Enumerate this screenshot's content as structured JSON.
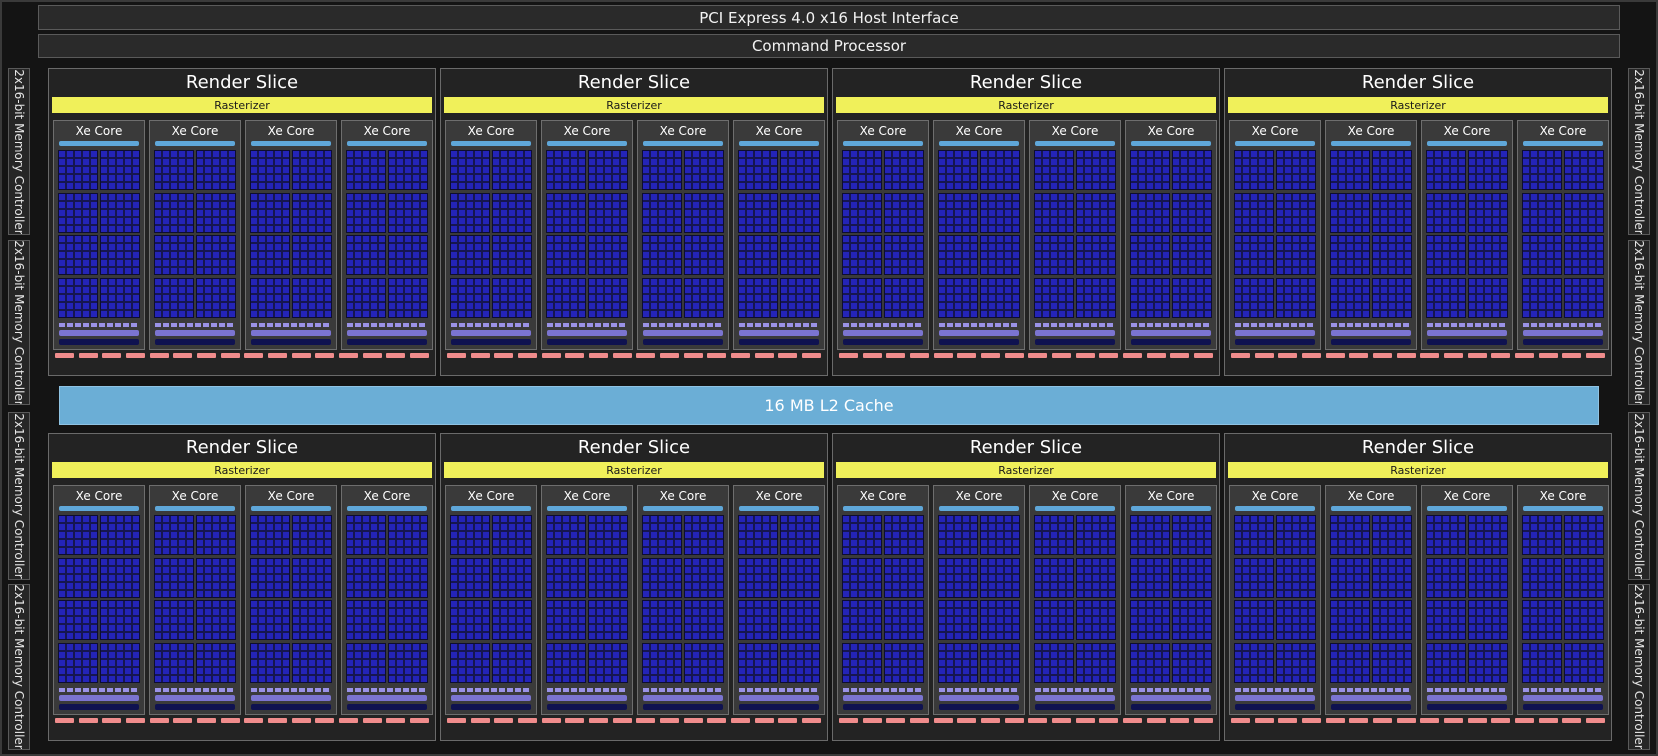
{
  "host_interface": "PCI Express 4.0 x16 Host Interface",
  "command_processor": "Command Processor",
  "l2_cache": "16 MB L2 Cache",
  "memory_controllers": [
    "2x16-bit Memory Controller",
    "2x16-bit Memory Controller",
    "2x16-bit Memory Controller",
    "2x16-bit Memory Controller",
    "2x16-bit Memory Controller",
    "2x16-bit Memory Controller",
    "2x16-bit Memory Controller",
    "2x16-bit Memory Controller"
  ],
  "render_slices": [
    {
      "title": "Render Slice",
      "rasterizer": "Rasterizer",
      "cores": [
        "Xe Core",
        "Xe Core",
        "Xe Core",
        "Xe Core"
      ]
    },
    {
      "title": "Render Slice",
      "rasterizer": "Rasterizer",
      "cores": [
        "Xe Core",
        "Xe Core",
        "Xe Core",
        "Xe Core"
      ]
    },
    {
      "title": "Render Slice",
      "rasterizer": "Rasterizer",
      "cores": [
        "Xe Core",
        "Xe Core",
        "Xe Core",
        "Xe Core"
      ]
    },
    {
      "title": "Render Slice",
      "rasterizer": "Rasterizer",
      "cores": [
        "Xe Core",
        "Xe Core",
        "Xe Core",
        "Xe Core"
      ]
    },
    {
      "title": "Render Slice",
      "rasterizer": "Rasterizer",
      "cores": [
        "Xe Core",
        "Xe Core",
        "Xe Core",
        "Xe Core"
      ]
    },
    {
      "title": "Render Slice",
      "rasterizer": "Rasterizer",
      "cores": [
        "Xe Core",
        "Xe Core",
        "Xe Core",
        "Xe Core"
      ]
    },
    {
      "title": "Render Slice",
      "rasterizer": "Rasterizer",
      "cores": [
        "Xe Core",
        "Xe Core",
        "Xe Core",
        "Xe Core"
      ]
    },
    {
      "title": "Render Slice",
      "rasterizer": "Rasterizer",
      "cores": [
        "Xe Core",
        "Xe Core",
        "Xe Core",
        "Xe Core"
      ]
    }
  ],
  "colors": {
    "rasterizer": "#f0f05a",
    "l2_cache": "#6baed6",
    "vector_engine": "#2424b8",
    "fixed_function": "#f08c8c"
  }
}
